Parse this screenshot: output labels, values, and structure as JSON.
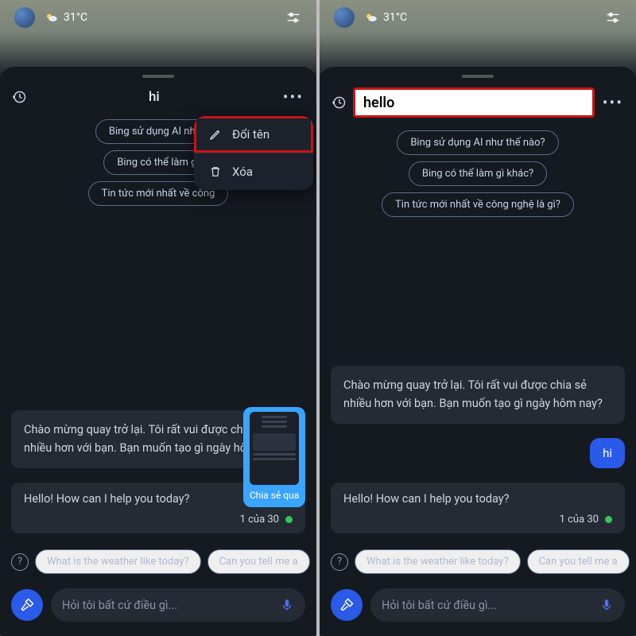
{
  "status": {
    "temp": "31°C"
  },
  "left": {
    "title": "hi",
    "chips": [
      "Bing sử dụng AI như t",
      "Bing có thể làm gì",
      "Tin tức mới nhất về công"
    ],
    "dropdown": {
      "rename": "Đổi tên",
      "delete": "Xóa"
    },
    "ai_greeting": "Chào mừng quay trở lại. Tôi rất vui được chia sẻ nhiều hơn với bạn. Bạn muốn tạo gì ngày hôm nay?",
    "reply": {
      "text": "Hello! How can I help you today?",
      "counter": "1 của 30"
    },
    "share_label": "Chia sẻ qua",
    "suggestions": [
      "What is the weather like today?",
      "Can you tell me a"
    ]
  },
  "right": {
    "title_input": "hello",
    "chips": [
      "Bing sử dụng AI như thế nào?",
      "Bing có thể làm gì khác?",
      "Tin tức mới nhất về công nghệ là gì?"
    ],
    "ai_greeting": "Chào mừng quay trở lại. Tôi rất vui được chia sẻ nhiều hơn với bạn. Bạn muốn tạo gì ngày hôm nay?",
    "user_msg": "hi",
    "reply": {
      "text": "Hello! How can I help you today?",
      "counter": "1 của 30"
    },
    "suggestions": [
      "What is the weather like today?",
      "Can you tell me a"
    ]
  },
  "input_placeholder": "Hỏi tôi bất cứ điều gì..."
}
